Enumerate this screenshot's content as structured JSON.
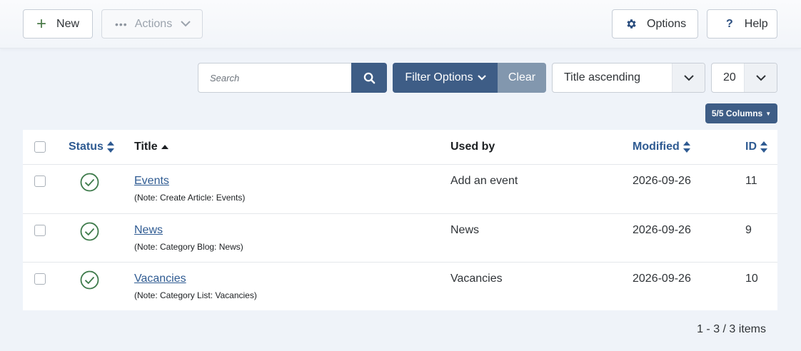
{
  "toolbar": {
    "new_label": "New",
    "actions_label": "Actions",
    "options_label": "Options",
    "help_label": "Help"
  },
  "filters": {
    "search_placeholder": "Search",
    "filter_options_label": "Filter Options",
    "clear_label": "Clear",
    "sort_value": "Title ascending",
    "limit_value": "20",
    "columns_label": "5/5 Columns"
  },
  "table": {
    "headers": {
      "status": "Status",
      "title": "Title",
      "used_by": "Used by",
      "modified": "Modified",
      "id": "ID"
    },
    "rows": [
      {
        "title": "Events",
        "note": "(Note: Create Article: Events)",
        "used_by": "Add an event",
        "modified": "2026-09-26",
        "id": "11",
        "status": "published"
      },
      {
        "title": "News",
        "note": "(Note: Category Blog: News)",
        "used_by": "News",
        "modified": "2026-09-26",
        "id": "9",
        "status": "published"
      },
      {
        "title": "Vacancies",
        "note": "(Note: Category List: Vacancies)",
        "used_by": "Vacancies",
        "modified": "2026-09-26",
        "id": "10",
        "status": "published"
      }
    ]
  },
  "pagination": {
    "summary": "1 - 3 / 3 items"
  },
  "colors": {
    "primary": "#3e5d86",
    "clear": "#8297ae",
    "link": "#2f5b92",
    "published": "#3d7a4a"
  },
  "icons": [
    "plus-icon",
    "ellipsis-icon",
    "chevron-down-icon",
    "gear-icon",
    "question-icon",
    "search-icon",
    "sort-icon",
    "sort-asc-icon",
    "check-circle-icon"
  ]
}
